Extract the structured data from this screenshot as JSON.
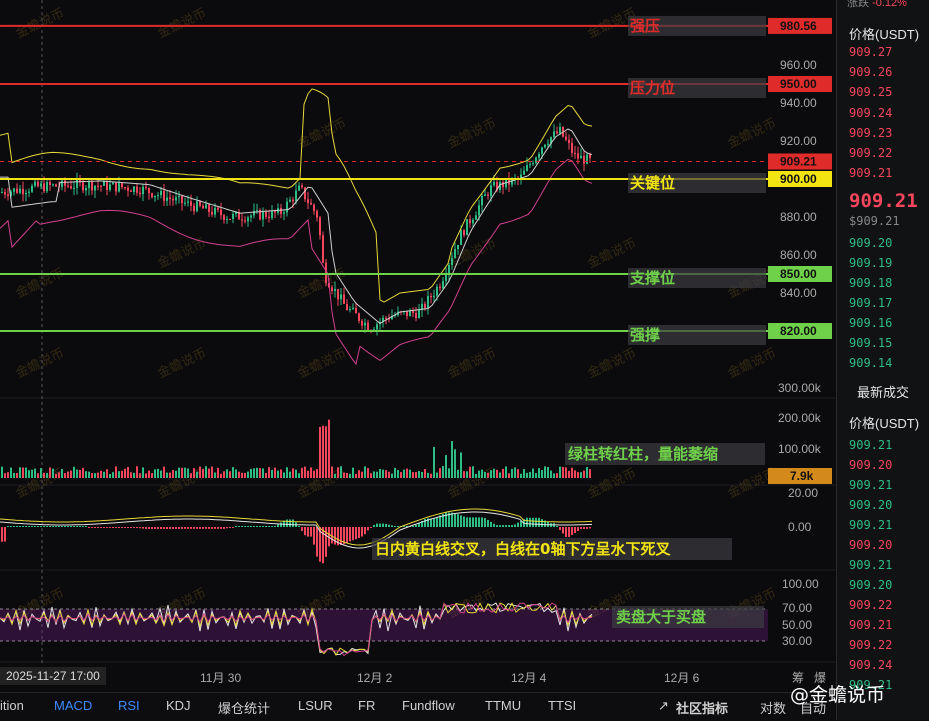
{
  "header": {
    "change_label": "涨跌",
    "change_value": "-0.12%"
  },
  "side_panel": {
    "orderbook_header": "价格(USDT)",
    "asks": [
      "909.27",
      "909.26",
      "909.25",
      "909.24",
      "909.23",
      "909.22",
      "909.21"
    ],
    "last_price": "909.21",
    "last_price_sub": "$909.21",
    "bids": [
      "909.20",
      "909.19",
      "909.18",
      "909.17",
      "909.16",
      "909.15",
      "909.14"
    ],
    "trades_title": "最新成交",
    "trades_header": "价格(USDT)",
    "trades": [
      {
        "p": "909.21",
        "side": "buy"
      },
      {
        "p": "909.20",
        "side": "sell"
      },
      {
        "p": "909.21",
        "side": "buy"
      },
      {
        "p": "909.20",
        "side": "buy"
      },
      {
        "p": "909.21",
        "side": "buy"
      },
      {
        "p": "909.20",
        "side": "sell"
      },
      {
        "p": "909.21",
        "side": "buy"
      },
      {
        "p": "909.20",
        "side": "buy"
      },
      {
        "p": "909.22",
        "side": "sell"
      },
      {
        "p": "909.21",
        "side": "sell"
      },
      {
        "p": "909.22",
        "side": "sell"
      },
      {
        "p": "909.24",
        "side": "sell"
      },
      {
        "p": "909.21",
        "side": "buy"
      }
    ],
    "colors": {
      "buy": "#2ebd85",
      "sell": "#f6465d"
    }
  },
  "bottom_tabs": [
    "ition",
    "MACD",
    "RSI",
    "KDJ",
    "爆仓统计",
    "LSUR",
    "FR",
    "Fundflow",
    "TTMU",
    "TTSI",
    "社区指标",
    "对数",
    "自动"
  ],
  "date_axis": {
    "cursor_label": "2025-11-27 17:00",
    "ticks": [
      "11月 30",
      "12月 2",
      "12月 4",
      "12月 6"
    ],
    "right_labels": [
      "筹",
      "爆"
    ]
  },
  "brand": "@金蟾说币",
  "watermark_text": "金蟾说币",
  "chart_data": {
    "type": "candlestick",
    "price_axis": {
      "ticks": [
        "960.00",
        "940.00",
        "920.00",
        "900.00",
        "880.00",
        "860.00",
        "840.00"
      ],
      "ylim": [
        800,
        990
      ]
    },
    "levels": [
      {
        "label": "强压",
        "value": "980.56",
        "color": "#e02b2b",
        "tag_bg": "#e02b2b"
      },
      {
        "label": "压力位",
        "value": "950.00",
        "color": "#e02b2b",
        "tag_bg": "#e02b2b"
      },
      {
        "label": "",
        "value": "909.21",
        "color": "#e02b2b",
        "tag_bg": "#e02b2b",
        "dashed": true
      },
      {
        "label": "关键位",
        "value": "900.00",
        "color": "#f2e312",
        "tag_bg": "#f2e312"
      },
      {
        "label": "支撑位",
        "value": "850.00",
        "color": "#6fd14a",
        "tag_bg": "#6fd14a"
      },
      {
        "label": "强撑",
        "value": "820.00",
        "color": "#6fd14a",
        "tag_bg": "#6fd14a"
      }
    ],
    "volume": {
      "ticks": [
        "300.00k",
        "200.00k",
        "100.00k"
      ],
      "last": "7.9k",
      "note": "绿柱转红柱，量能萎缩"
    },
    "macd": {
      "ticks": [
        "20.00",
        "0.00"
      ],
      "note": "日内黄白线交叉，白线在0轴下方呈水下死叉"
    },
    "rsi": {
      "ticks": [
        "100.00",
        "70.00",
        "50.00",
        "30.00"
      ],
      "note": "卖盘大于买盘"
    },
    "colors": {
      "up": "#2ebd85",
      "down": "#f6465d",
      "boll_upper": "#e8d83a",
      "boll_mid": "#d0d0d0",
      "boll_lower": "#d0408f"
    }
  }
}
